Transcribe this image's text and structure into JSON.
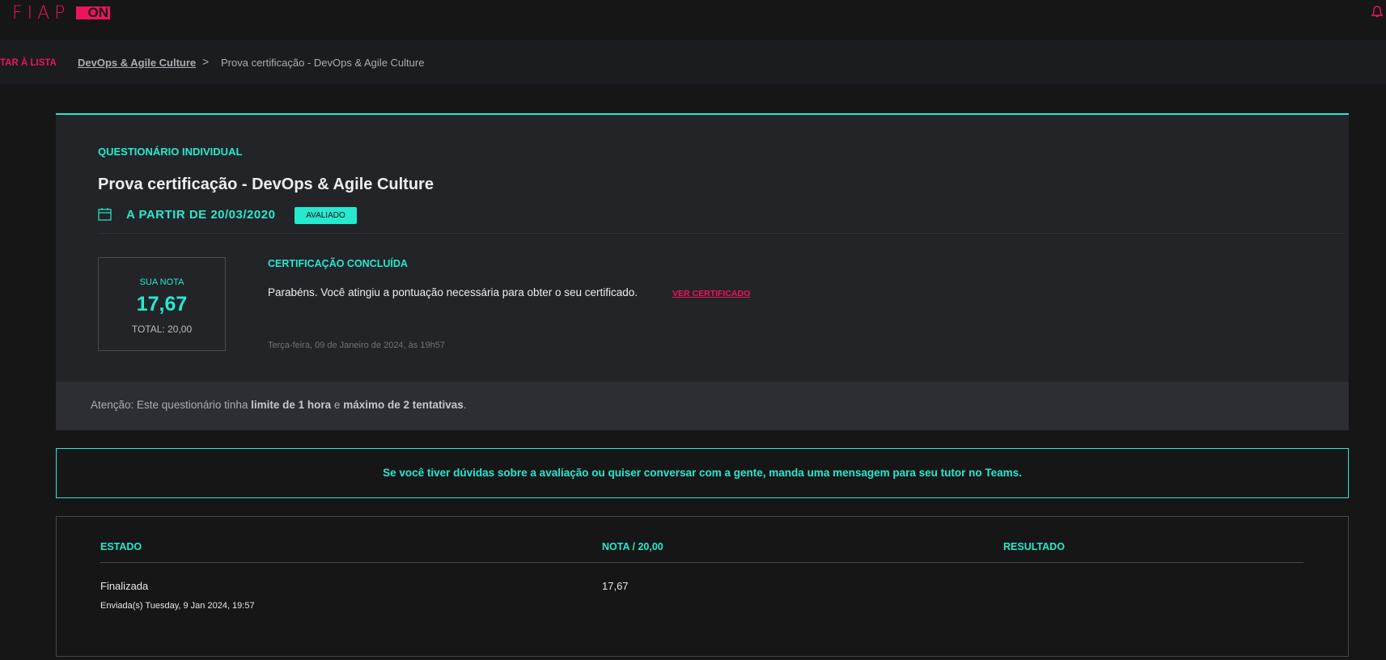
{
  "header": {
    "logo_text": "FIAP",
    "logo_badge": "ON",
    "notifications_icon": "bell-icon"
  },
  "breadcrumb": {
    "back_label": "TAR À LISTA",
    "course": "DevOps & Agile Culture",
    "separator": ">",
    "current": "Prova certificação - DevOps & Agile Culture"
  },
  "quiz": {
    "type": "QUESTIONÁRIO INDIVIDUAL",
    "title": "Prova certificação - DevOps & Agile Culture",
    "date_label": "A PARTIR DE 20/03/2020",
    "status_badge": "AVALIADO",
    "score_label": "SUA NOTA",
    "score": "17,67",
    "total": "TOTAL: 20,00",
    "cert_heading": "CERTIFICAÇÃO CONCLUÍDA",
    "cert_message": "Parabéns. Você atingiu a pontuação necessária para obter o seu certificado.",
    "cert_link": "VER CERTIFICADO",
    "cert_date": "Terça-feira, 09 de Janeiro de 2024, às 19h57",
    "attention_prefix": "Atenção: Este questionário tinha ",
    "attention_limit": "limite de 1 hora",
    "attention_mid": " e ",
    "attention_attempts": "máximo de 2 tentativas",
    "attention_suffix": "."
  },
  "help_message": "Se você tiver dúvidas sobre a avaliação ou quiser conversar com a gente, manda uma mensagem para seu tutor no Teams.",
  "attempts": {
    "headers": [
      "ESTADO",
      "NOTA / 20,00",
      "RESULTADO"
    ],
    "rows": [
      {
        "state": "Finalizada",
        "submitted": "Enviada(s) Tuesday, 9 Jan 2024, 19:57",
        "grade": "17,67",
        "result": ""
      }
    ]
  },
  "colors": {
    "accent": "#26e9cf",
    "brand": "#ed145b"
  }
}
